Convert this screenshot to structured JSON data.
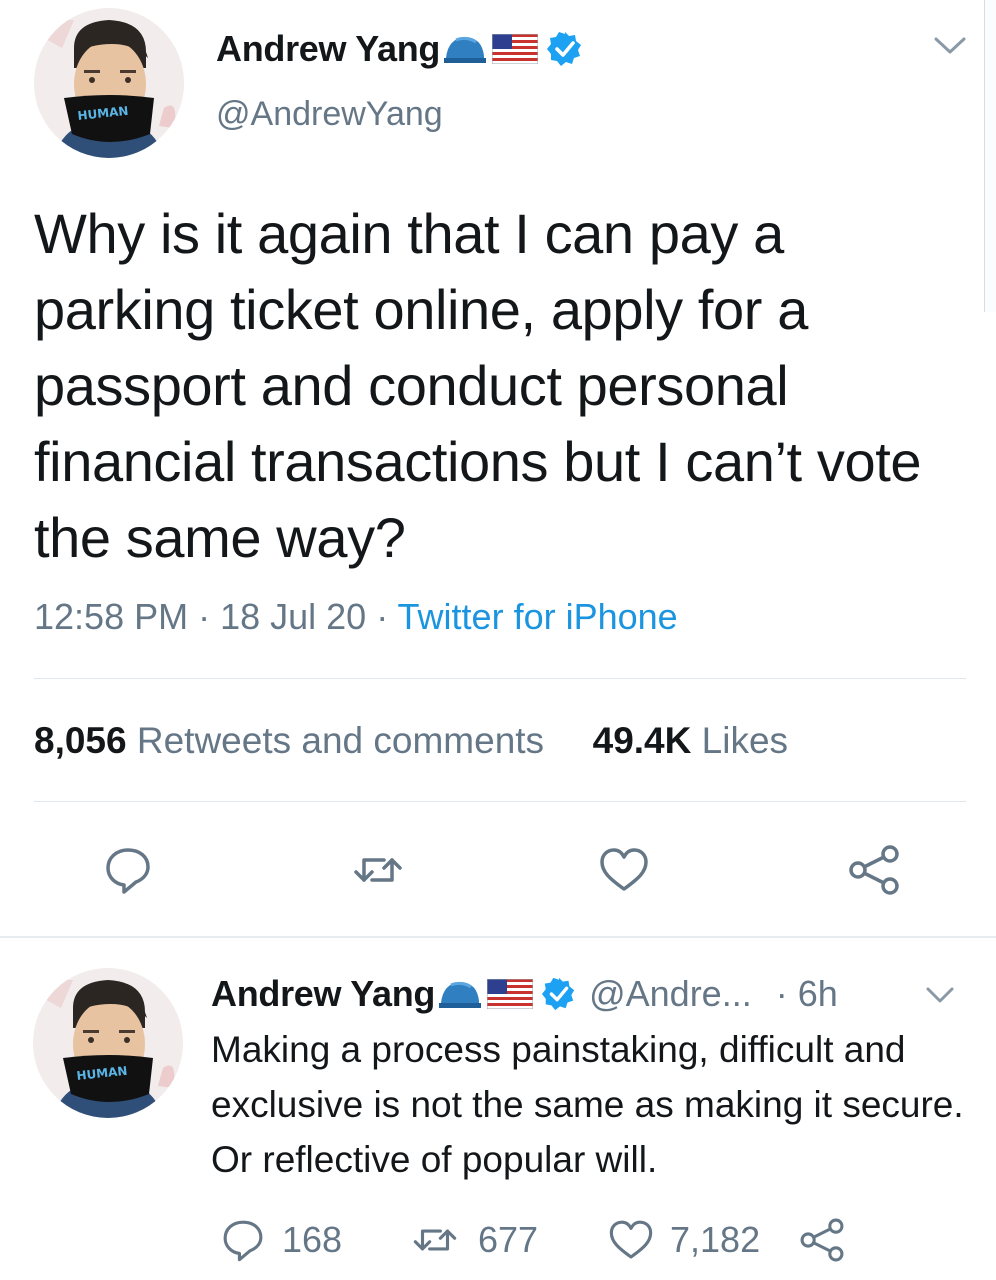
{
  "colors": {
    "text_primary": "#14171a",
    "text_secondary": "#657786",
    "link": "#1b95e0",
    "verified": "#1da1f2",
    "divider": "#e1e8ed"
  },
  "tweet": {
    "author": {
      "display_name": "Andrew Yang",
      "handle": "@AndrewYang",
      "mask_text": "HUMAN",
      "badges": [
        "blue-cap-emoji",
        "us-flag-emoji",
        "verified-badge"
      ]
    },
    "text": "Why is it again that I can pay a parking ticket online, apply for a passport and conduct personal financial transactions but I can’t vote the same way?",
    "time": "12:58 PM",
    "separator": " · ",
    "date": "18 Jul 20",
    "source": "Twitter for iPhone",
    "stats": {
      "retweets_count": "8,056",
      "retweets_label": "Retweets and comments",
      "likes_count": "49.4K",
      "likes_label": "Likes"
    },
    "actions": [
      "reply-icon",
      "retweet-icon",
      "like-icon",
      "share-icon"
    ]
  },
  "reply": {
    "author": {
      "display_name": "Andrew Yang",
      "handle": "@Andre...",
      "mask_text": "HUMAN"
    },
    "time": "· 6h",
    "text": "Making a process painstaking, difficult and exclusive is not the same as making it secure. Or reflective of popular will.",
    "counts": {
      "replies": "168",
      "retweets": "677",
      "likes": "7,182"
    }
  }
}
